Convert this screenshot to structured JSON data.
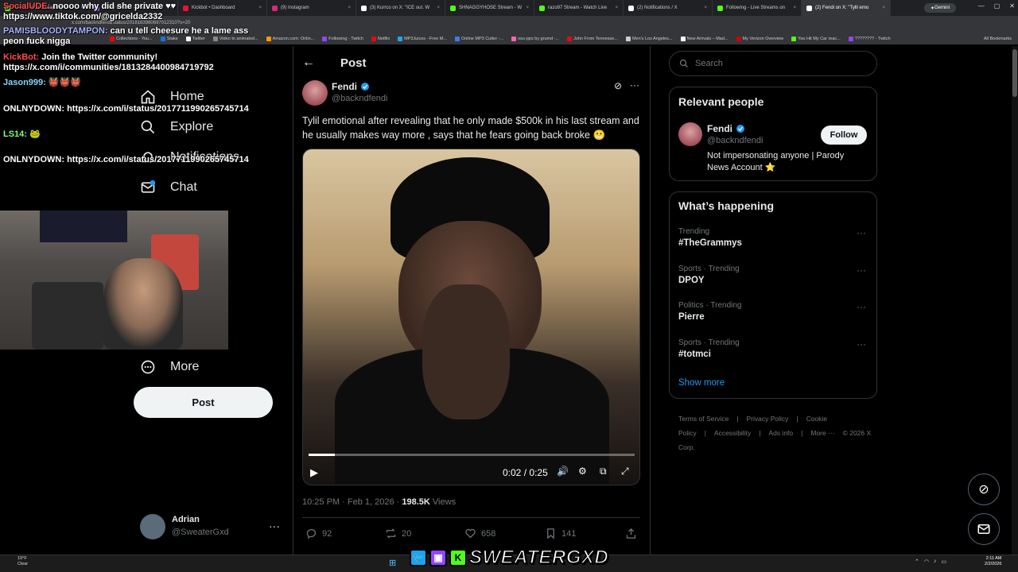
{
  "browser": {
    "tabs": [
      {
        "label": "Home - Kick Streaming",
        "color": "#53fc18"
      },
      {
        "label": "Vaxzy Stream - Watch Live",
        "color": "#9146ff"
      },
      {
        "label": "Kickbot • Dashboard",
        "color": "#e9113c"
      },
      {
        "label": "(9) Instagram",
        "color": "#d62976"
      },
      {
        "label": "(3) Kurrco on X: \"ICE out. W",
        "color": "#ffffff"
      },
      {
        "label": "SHNAGGYHOSE Stream - W",
        "color": "#53fc18"
      },
      {
        "label": "razo97 Stream - Watch Live",
        "color": "#53fc18"
      },
      {
        "label": "(2) Notifications / X",
        "color": "#ffffff"
      },
      {
        "label": "Following - Live Streams on",
        "color": "#53fc18"
      },
      {
        "label": "(2) Fendi on X: \"Tylil emo",
        "color": "#ffffff"
      }
    ],
    "gemini_label": "Gemini",
    "url": "x.com/backndfendi/status/2018163960697012310?s=20",
    "bookmarks": [
      {
        "label": "Collections - You...",
        "color": "#ff0000"
      },
      {
        "label": "Stake",
        "color": "#1475e1"
      },
      {
        "label": "Twitter",
        "color": "#ffffff"
      },
      {
        "label": "Video to animated...",
        "color": "#888888"
      },
      {
        "label": "Amazon.com: Onlin...",
        "color": "#ff9900"
      },
      {
        "label": "Following - Twitch",
        "color": "#9146ff"
      },
      {
        "label": "Netflix",
        "color": "#e50914"
      },
      {
        "label": "MP3Juices - Free M...",
        "color": "#2ba1e6"
      },
      {
        "label": "Online MP3 Cutter -...",
        "color": "#3e7fe0"
      },
      {
        "label": "osu-pps by grumd -...",
        "color": "#ff66aa"
      },
      {
        "label": "John From Tennesse...",
        "color": "#e50914"
      },
      {
        "label": "Men's Los Angeles...",
        "color": "#cccccc"
      },
      {
        "label": "New Arrivals – Mad...",
        "color": "#ffffff"
      },
      {
        "label": "My Verizon Overview",
        "color": "#cd040b"
      },
      {
        "label": "You Hit My Car reac...",
        "color": "#53fc18"
      },
      {
        "label": "???????? - Twitch",
        "color": "#9146ff"
      }
    ],
    "all_bookmarks": "All Bookmarks"
  },
  "overlay_chat": {
    "lines": [
      {
        "user": "SocialUDE:",
        "user_color": "#ff4d4d",
        "text": "noooo why did she private ♥♥"
      },
      {
        "user": "",
        "user_color": "#ffffff",
        "text": "https://www.tiktok.com/@gricelda2332"
      },
      {
        "user": "PAMISBLOODYTAMPON:",
        "user_color": "#a7b4ff",
        "text": "can u tell cheesure he a lame ass peon fuck nigga"
      },
      {
        "user": "KickBot:",
        "user_color": "#ff4d4d",
        "text": "Join the Twitter community! https://x.com/i/communities/1813284400984719792"
      },
      {
        "user": "Jason999:",
        "user_color": "#7fd6ff",
        "text": "👹👹👹"
      },
      {
        "user": "ONLNYDOWN:",
        "user_color": "#ffffff",
        "text": "https://x.com/i/status/2017711990265745714"
      },
      {
        "user": "LS14:",
        "user_color": "#7fff7f",
        "text": "🐸"
      },
      {
        "user": "ONLNYDOWN:",
        "user_color": "#ffffff",
        "text": "https://x.com/i/status/2017711990265745714"
      }
    ]
  },
  "nav": {
    "items": [
      {
        "label": "Home",
        "icon": "home-icon"
      },
      {
        "label": "Explore",
        "icon": "search-icon"
      },
      {
        "label": "Notifications",
        "icon": "bell-icon"
      },
      {
        "label": "Chat",
        "icon": "chat-icon"
      },
      {
        "label": "More",
        "icon": "more-circle-icon"
      }
    ],
    "post_button": "Post"
  },
  "account": {
    "name": "Adrian",
    "handle": "@SweaterGxd"
  },
  "main": {
    "header_title": "Post",
    "author": {
      "name": "Fendi",
      "handle": "@backndfendi"
    },
    "text": "Tylil emotional after revealing that he only made $500k in his last stream and he usually makes way more , says that he fears going back broke 😬",
    "video": {
      "current_time": "0:02",
      "separator": "/",
      "duration": "0:25",
      "progress_fraction": 0.08
    },
    "meta": {
      "time": "10:25 PM",
      "date": "Feb 1, 2026",
      "views_count": "198.5K",
      "views_label": "Views"
    },
    "stats": {
      "replies": "92",
      "reposts": "20",
      "likes": "658",
      "bookmarks": "141"
    }
  },
  "sidebar": {
    "search_placeholder": "Search",
    "relevant": {
      "title": "Relevant people",
      "name": "Fendi",
      "handle": "@backndfendi",
      "follow_label": "Follow",
      "bio": "Not impersonating anyone | Parody News Account ⭐"
    },
    "happening": {
      "title": "What’s happening",
      "trends": [
        {
          "category": "Trending",
          "name": "#TheGrammys"
        },
        {
          "category": "Sports · Trending",
          "name": "DPOY"
        },
        {
          "category": "Politics · Trending",
          "name": "Pierre"
        },
        {
          "category": "Sports · Trending",
          "name": "#totmci"
        }
      ],
      "show_more": "Show more"
    },
    "footer": {
      "links": [
        "Terms of Service",
        "|",
        "Privacy Policy",
        "|",
        "Cookie Policy",
        "|",
        "Accessibility",
        "|",
        "Ads info",
        "|",
        "More ···",
        "© 2026 X Corp."
      ]
    }
  },
  "taskbar": {
    "weather_temp": "19°F",
    "weather_desc": "Clear",
    "time": "2:11 AM",
    "date": "2/2/2026",
    "brand": "SWEATERGXD"
  },
  "colors": {
    "accent": "#1d9bf0",
    "verified": "#1d9bf0",
    "kick_green": "#53fc18",
    "twitch_purple": "#9146ff",
    "twitter_blue": "#1da1f2"
  }
}
